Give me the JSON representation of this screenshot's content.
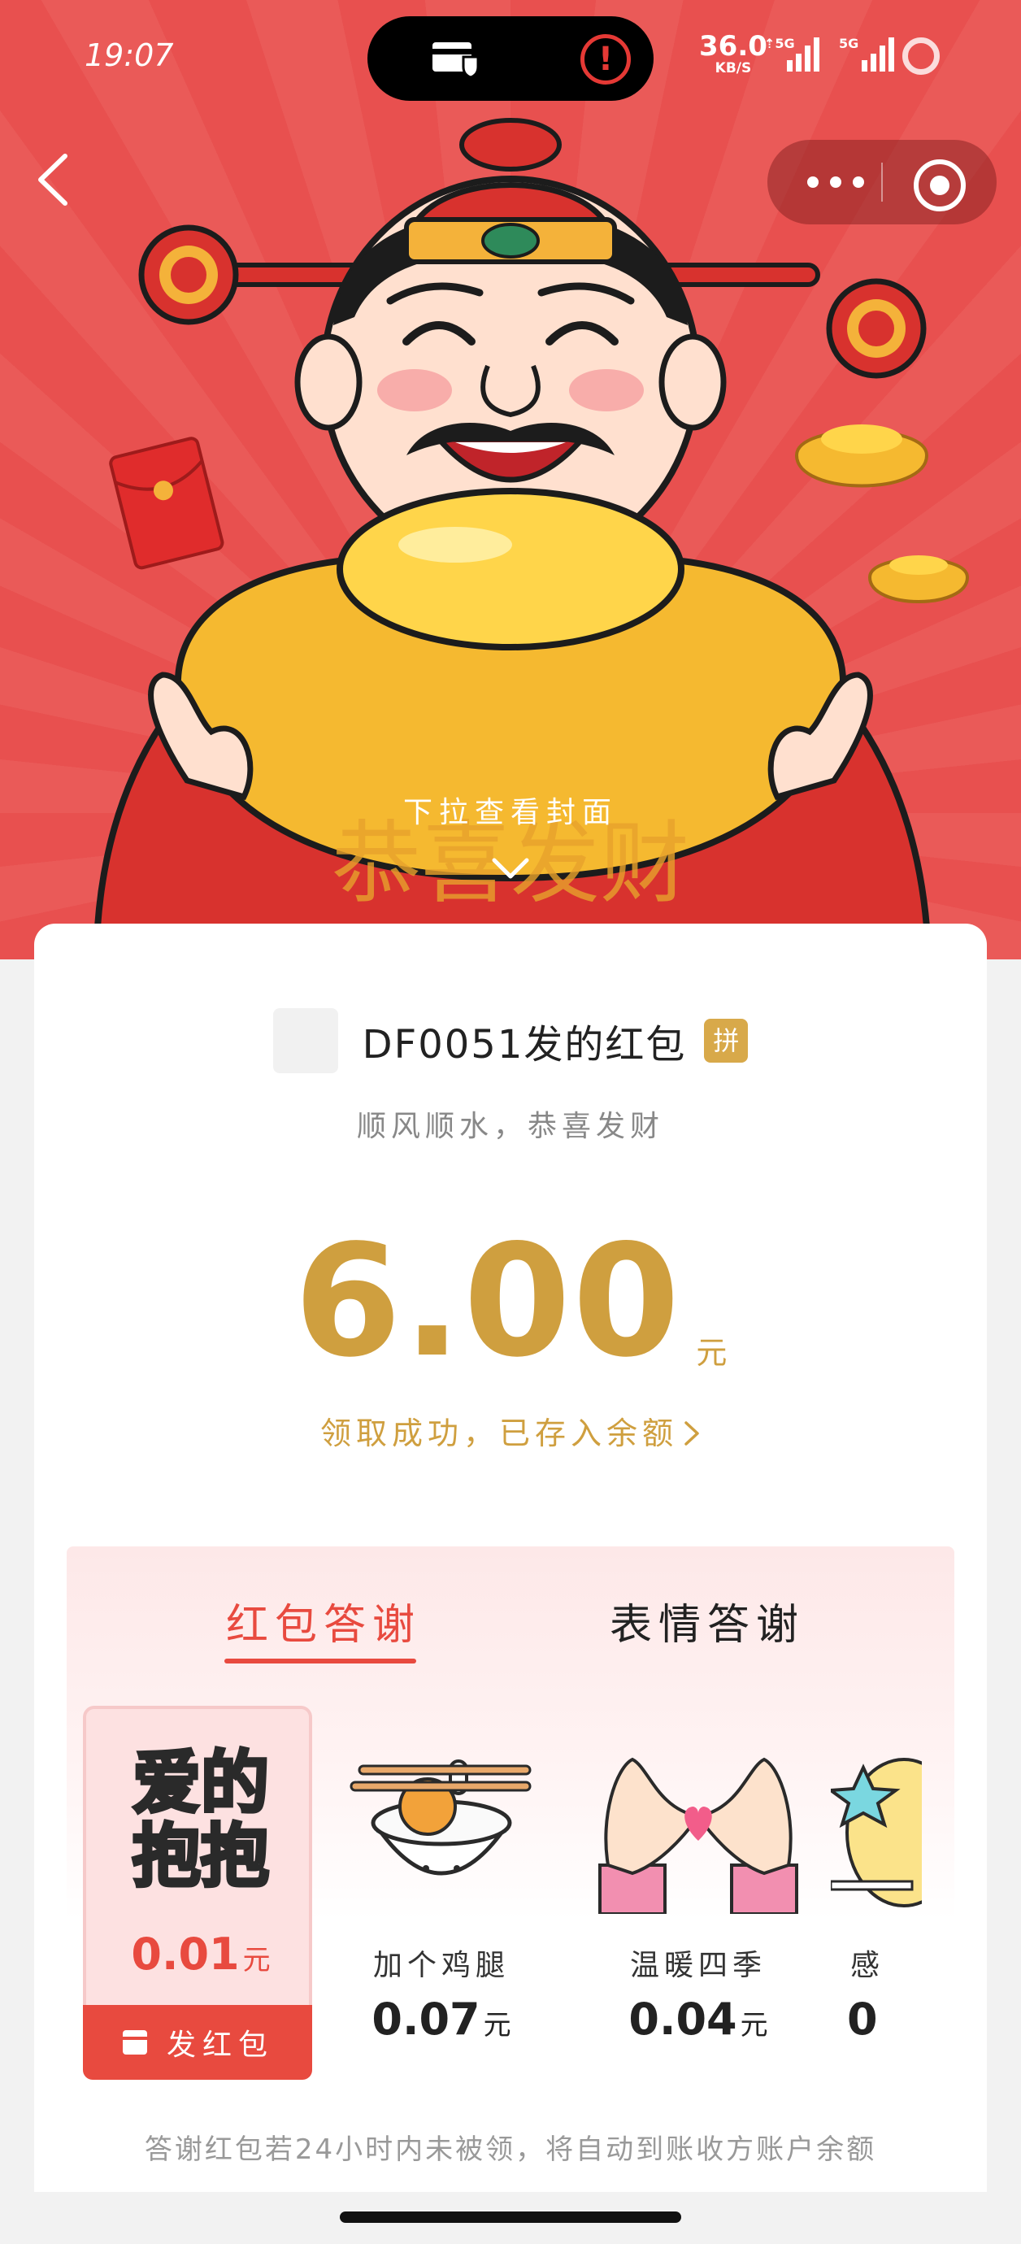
{
  "status_bar": {
    "time": "19:07",
    "speed_value": "36.0",
    "speed_unit": "KB/S",
    "sim1_label": "⇡5G",
    "sim2_label": "5G"
  },
  "cover": {
    "pull_hint": "下拉查看封面",
    "ingot_text": "恭喜发财"
  },
  "envelope": {
    "sender_title": "DF0051发的红包",
    "badge": "拼",
    "blessing": "顺风顺水，恭喜发财",
    "amount": "6.00",
    "currency": "元",
    "status": "领取成功，已存入余额"
  },
  "thanks": {
    "tabs": [
      {
        "label": "红包答谢",
        "active": true
      },
      {
        "label": "表情答谢",
        "active": false
      }
    ],
    "items": [
      {
        "title_line1": "爱的",
        "title_line2": "抱抱",
        "price": "0.01",
        "unit": "元",
        "selected": true,
        "action": "发红包"
      },
      {
        "label": "加个鸡腿",
        "price": "0.07",
        "unit": "元"
      },
      {
        "label": "温暖四季",
        "price": "0.04",
        "unit": "元"
      },
      {
        "label": "感",
        "price": "0"
      }
    ],
    "footnote": "答谢红包若24小时内未被领，将自动到账收方账户余额"
  },
  "colors": {
    "brand_red": "#e84a3f",
    "gold": "#cf9f3f",
    "cover_red": "#e8504f"
  }
}
